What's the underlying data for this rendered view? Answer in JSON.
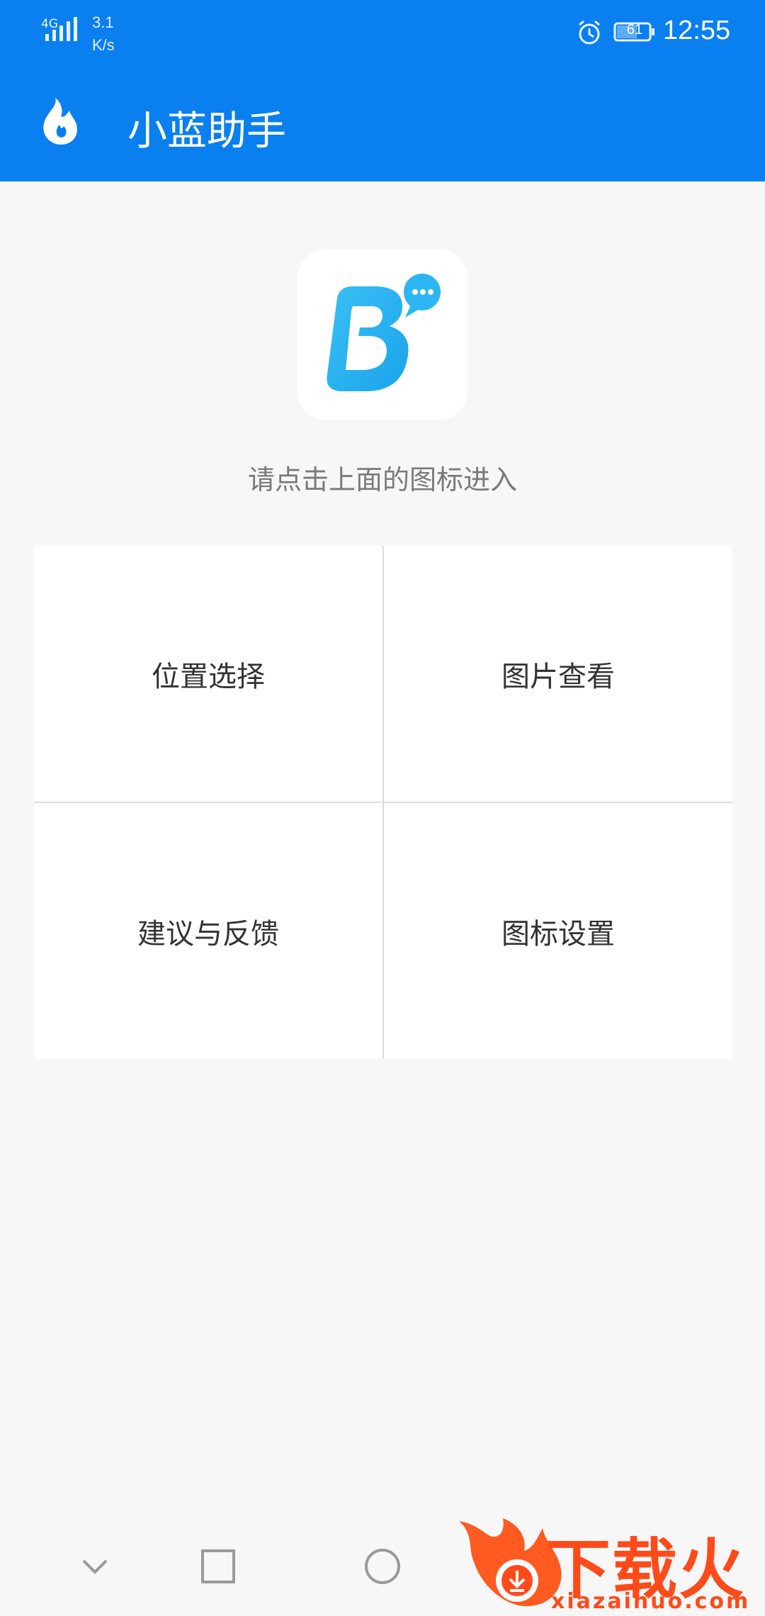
{
  "status_bar": {
    "network": "4G",
    "speed_value": "3.1",
    "speed_unit": "K/s",
    "battery": "61",
    "time": "12:55"
  },
  "app_bar": {
    "title": "小蓝助手",
    "logo_icon": "flame-logo-icon"
  },
  "main": {
    "app_icon": "b-chat-app-icon",
    "hint": "请点击上面的图标进入",
    "menu": [
      {
        "label": "位置选择"
      },
      {
        "label": "图片查看"
      },
      {
        "label": "建议与反馈"
      },
      {
        "label": "图标设置"
      }
    ]
  },
  "nav_bar": {
    "icons": [
      "back-chevron-icon",
      "recent-apps-icon",
      "home-icon"
    ]
  },
  "watermark": {
    "text": "下载火",
    "url": "xiazaihuo.com"
  },
  "colors": {
    "primary": "#0a7ff0",
    "background": "#f7f7f7",
    "accent_orange": "#ff4a1a"
  }
}
